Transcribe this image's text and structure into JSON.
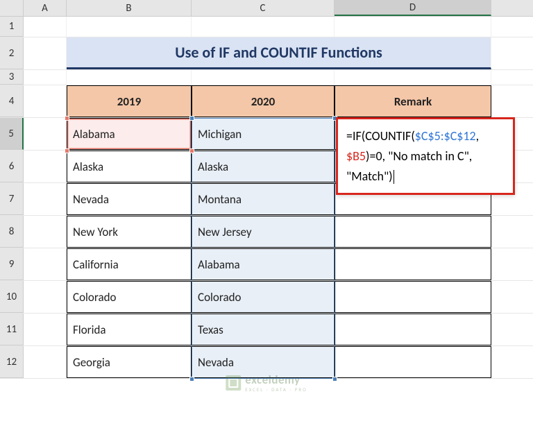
{
  "columns": [
    "A",
    "B",
    "C",
    "D"
  ],
  "rows": [
    "1",
    "2",
    "3",
    "4",
    "5",
    "6",
    "7",
    "8",
    "9",
    "10",
    "11",
    "12"
  ],
  "title": "Use of IF and COUNTIF Functions",
  "headers": {
    "B": "2019",
    "C": "2020",
    "D": "Remark"
  },
  "data": {
    "B": [
      "Alabama",
      "Alaska",
      "Nevada",
      "New York",
      "California",
      "Colorado",
      "Florida",
      "Georgia"
    ],
    "C": [
      "Michigan",
      "Alaska",
      "Montana",
      "New Jersey",
      "Alabama",
      "Colorado",
      "Texas",
      "Nevada"
    ]
  },
  "formula": {
    "p1": "=IF(COUNTIF(",
    "p2": "$C$5:$C$12",
    "p3": ",",
    "p4": "$B5",
    "p5": ")=0, \"No match in C\", \"Match\")"
  },
  "watermark": {
    "main": "exceldemy",
    "sub": "EXCEL · DATA · PRO"
  },
  "active": {
    "col": "D",
    "row": "5"
  }
}
